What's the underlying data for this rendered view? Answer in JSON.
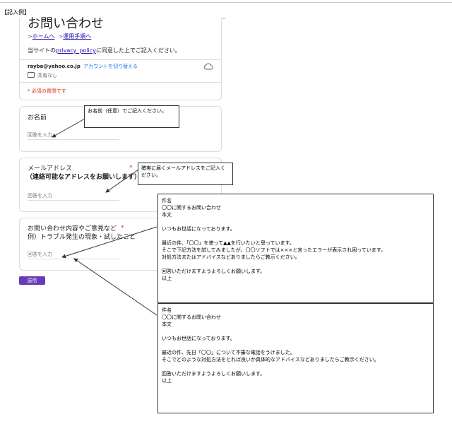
{
  "example_tag": "【記入例】",
  "form": {
    "title": "お問い合わせ",
    "breadcrumbs": [
      {
        "sep": ">",
        "label": "ホームへ"
      },
      {
        "sep": ">",
        "label": "運用手順へ"
      }
    ],
    "consent": {
      "prefix": "当サイトの",
      "link": "privacy_policy",
      "suffix": "に同意した上でご記入ください。"
    },
    "account": {
      "email": "rayba@yahoo.co.jp",
      "switch_label": "アカウントを切り替える",
      "share_status": "共有なし"
    },
    "required_note": "* 必須の質問です",
    "questions": [
      {
        "label": "お名前",
        "placeholder": "回答を入力"
      },
      {
        "label": "メールアドレス",
        "sublabel": "（連絡可能なアドレスをお願いします）",
        "required": "*",
        "placeholder": "回答を入力"
      },
      {
        "label": "お問い合わせ内容やご意見など",
        "sublabel": "例）トラブル発生の現象・試したこと",
        "required": "*",
        "placeholder": "回答を入力"
      }
    ],
    "submit_label": "送信"
  },
  "callouts": {
    "name": "お名前（任意）でご記入ください。",
    "email": "確実に届くメールアドレスをご記入ください。"
  },
  "examples": [
    {
      "lines": [
        "件名",
        "〇〇に関するお問い合わせ",
        "本文",
        "",
        "いつもお世話になっております。",
        "",
        "最近の件、「〇〇」を使って▲▲を行いたいと思っています。",
        "そこで下記方法を試してみましたが、〇〇ソフトでは×××と言ったエラーが表示され困っています。",
        "対処方法またはアドバイスなどありましたらご教示ください。",
        "",
        "回答いただけますようよろしくお願いします。",
        "以上"
      ]
    },
    {
      "lines": [
        "件名",
        "〇〇に関するお問い合わせ",
        "本文",
        "",
        "いつもお世話になっております。",
        "",
        "最近の件、先日「〇〇」について不審な電話をうけました。",
        "そこでどのような対処方法をとれば良いか具体的なアドバイスなどありましたらご教示ください。",
        "",
        "回答いただけますようよろしくお願いします。",
        "以上"
      ]
    }
  ],
  "colors": {
    "accent": "#673ab7",
    "link": "#1a0dab",
    "required": "#d93025"
  }
}
